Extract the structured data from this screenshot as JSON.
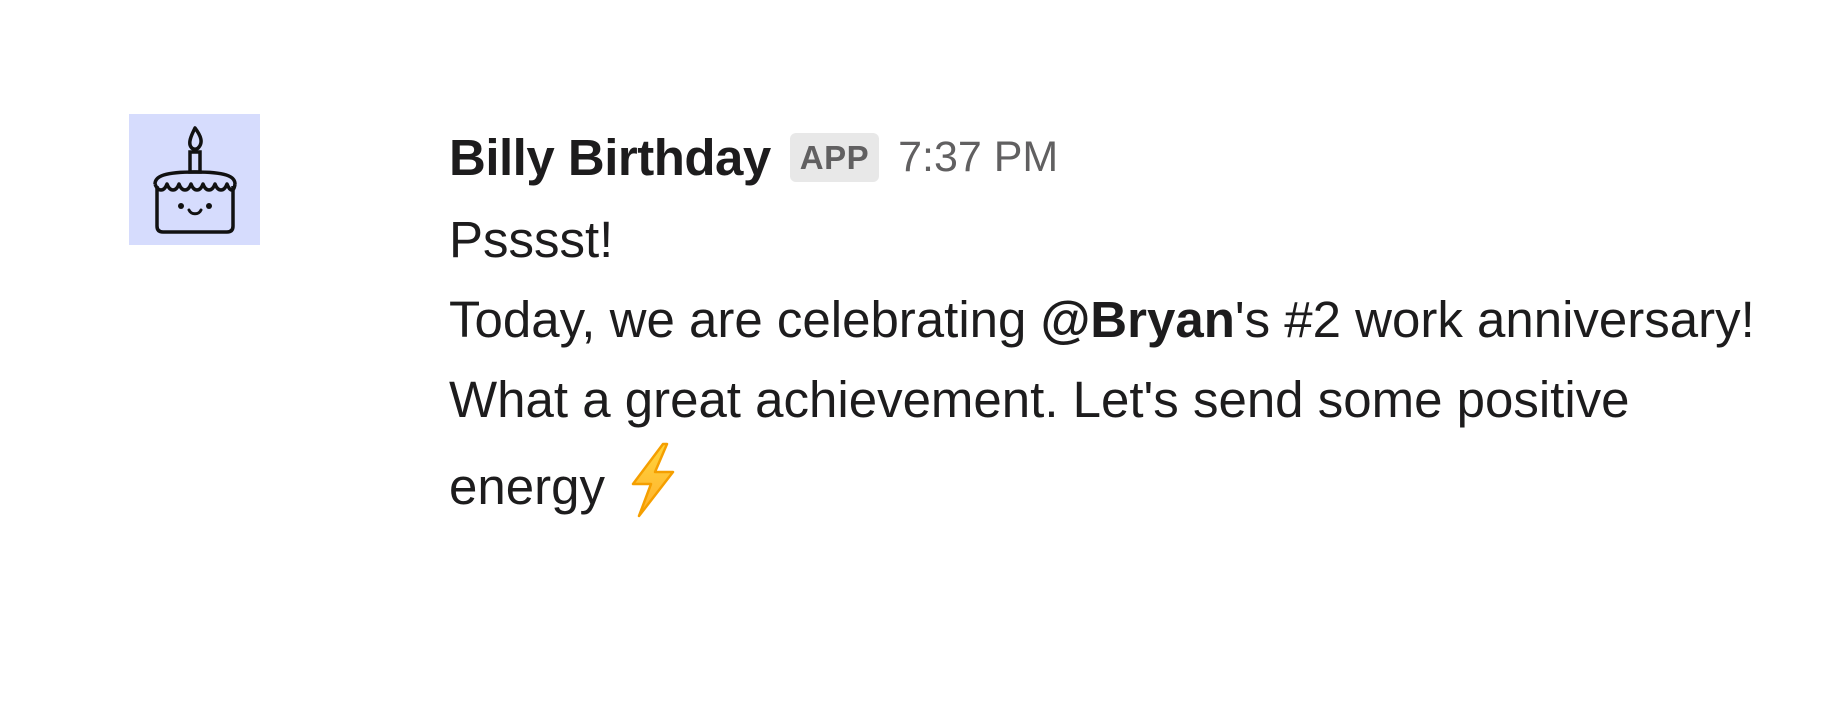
{
  "message": {
    "sender_name": "Billy Birthday",
    "app_badge": "APP",
    "timestamp": "7:37 PM",
    "avatar_icon": "birthday-cake-icon",
    "avatar_bg": "#d6dcfd",
    "lines": {
      "line1": "Psssst!",
      "line2_before": "Today, we are celebrating ",
      "line2_mention": "@Bryan",
      "line2_after": "'s #2 work anniversary!",
      "line3": "What a great achievement. Let's send some positive",
      "line4": "energy"
    },
    "emoji": "high-voltage-emoji"
  }
}
